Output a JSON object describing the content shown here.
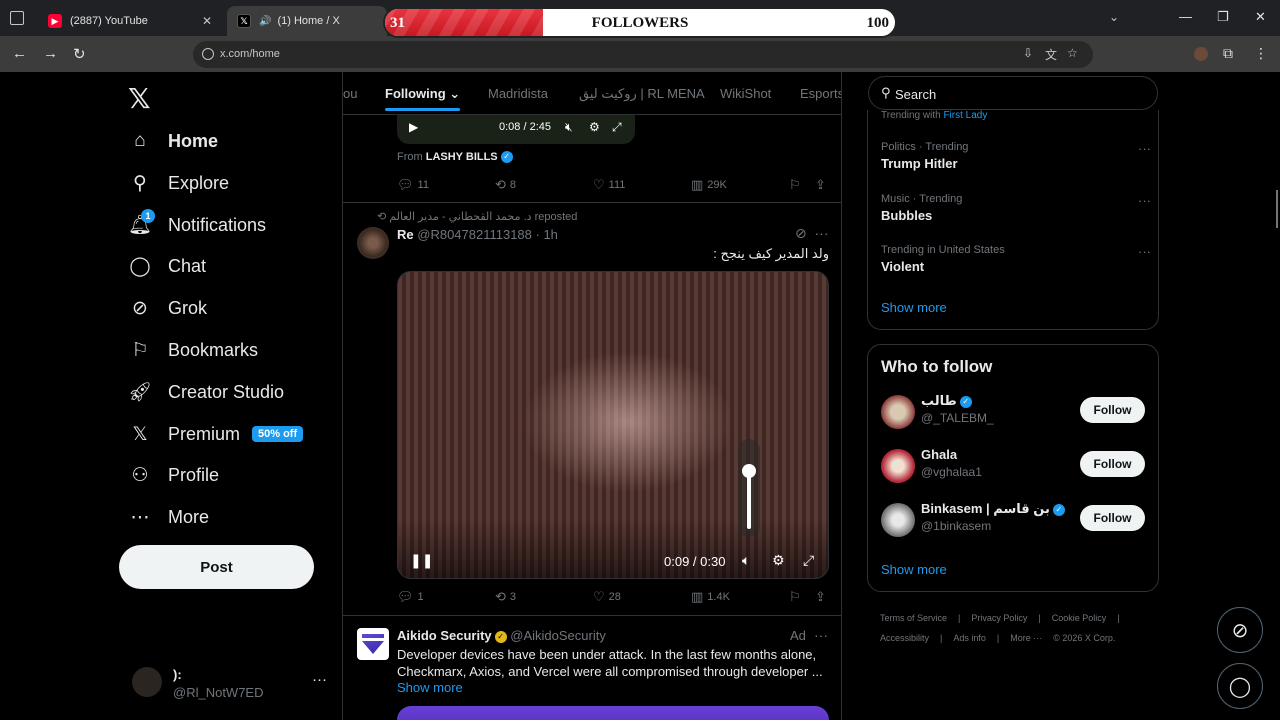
{
  "browser": {
    "tabs": [
      {
        "title": "(2887) YouTube",
        "favicon": "youtube-icon"
      },
      {
        "title": "(1) Home / X",
        "favicon": "x-icon",
        "audio": true
      }
    ],
    "url": "x.com/home"
  },
  "overlay": {
    "left": "31",
    "label": "FOLLOWERS",
    "right": "100",
    "progress": 0.31
  },
  "nav": {
    "items": [
      {
        "label": "Home",
        "icon": "home-icon",
        "active": true
      },
      {
        "label": "Explore",
        "icon": "search-icon"
      },
      {
        "label": "Notifications",
        "icon": "bell-icon",
        "badge": "1"
      },
      {
        "label": "Chat",
        "icon": "chat-icon"
      },
      {
        "label": "Grok",
        "icon": "grok-icon"
      },
      {
        "label": "Bookmarks",
        "icon": "bookmark-icon"
      },
      {
        "label": "Creator Studio",
        "icon": "rocket-icon"
      },
      {
        "label": "Premium",
        "icon": "x-icon",
        "promo": "50% off"
      },
      {
        "label": "Profile",
        "icon": "person-icon"
      },
      {
        "label": "More",
        "icon": "more-circle-icon"
      }
    ],
    "post_label": "Post",
    "account": {
      "name": "):",
      "handle": "@Rl_NotW7ED"
    }
  },
  "feed_tabs": [
    "ou",
    "Following",
    "Madridista",
    "روكيت ليق | RL MENA",
    "WikiShot",
    "Esports"
  ],
  "post1": {
    "video_time": "0:08 / 2:45",
    "from_prefix": "From",
    "from_name": "LASHY BILLS",
    "replies": "11",
    "reposts": "8",
    "likes": "111",
    "views": "29K"
  },
  "post2": {
    "reposted_by": "د. محمد القحطاني - مدير العالم reposted",
    "name": "Re",
    "handle_time": "@R8047821113188 · 1h",
    "text": "ولد المدير كيف ينجح :",
    "video_time": "0:09 / 0:30",
    "volume": 0.85,
    "replies": "1",
    "reposts": "3",
    "likes": "28",
    "views": "1.4K"
  },
  "post3": {
    "name": "Aikido Security",
    "handle": "@AikidoSecurity",
    "ad_label": "Ad",
    "text": "Developer devices have been under attack. In the last few months alone, Checkmarx, Axios, and Vercel were all compromised through developer ...",
    "show_more": "Show more"
  },
  "right": {
    "search_placeholder": "Search",
    "trend_cut_prefix": "Trending with",
    "trend_cut_link": "First Lady",
    "trends": [
      {
        "category": "Politics · Trending",
        "title": "Trump Hitler"
      },
      {
        "category": "Music · Trending",
        "title": "Bubbles"
      },
      {
        "category": "Trending in United States",
        "title": "Violent"
      }
    ],
    "show_more": "Show more",
    "who_to_follow": "Who to follow",
    "suggestions": [
      {
        "name": "طالب",
        "handle": "@_TALEBM_",
        "verified": true,
        "follow": "Follow"
      },
      {
        "name": "Ghala",
        "handle": "@vghalaa1",
        "verified": false,
        "follow": "Follow"
      },
      {
        "name": "Binkasem | بن قاسم",
        "handle": "@1binkasem",
        "verified": true,
        "follow": "Follow"
      }
    ],
    "wtf_show_more": "Show more",
    "footer": [
      "Terms of Service",
      "|",
      "Privacy Policy",
      "|",
      "Cookie Policy",
      "|",
      "Accessibility",
      "|",
      "Ads info",
      "|",
      "More ···",
      "© 2026 X Corp."
    ]
  },
  "colors": {
    "accent": "#1d9bf0",
    "background": "#000000",
    "text": "#e7e9ea",
    "muted": "#71767b",
    "overlay_fill": "#d61f2a"
  }
}
